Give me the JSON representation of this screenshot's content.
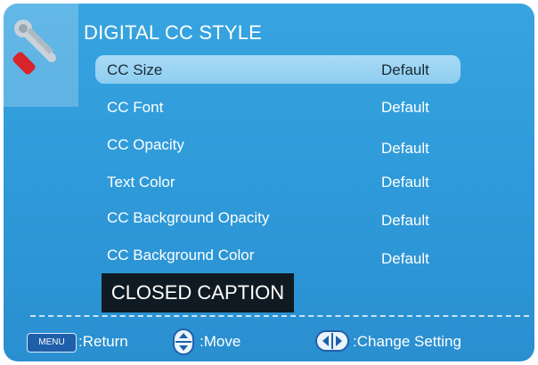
{
  "title": "DIGITAL CC STYLE",
  "menu": [
    {
      "label": "CC Size",
      "value": "Default",
      "selected": true
    },
    {
      "label": "CC Font",
      "value": "Default"
    },
    {
      "label": "CC Opacity",
      "value": "Default"
    },
    {
      "label": "Text Color",
      "value": "Default"
    },
    {
      "label": "CC Background Opacity",
      "value": "Default"
    },
    {
      "label": "CC Background Color",
      "value": "Default"
    }
  ],
  "preview_text": "CLOSED CAPTION",
  "footer": {
    "menu_key": "MENU",
    "return_label": ":Return",
    "move_label": ":Move",
    "change_label": ":Change Setting"
  },
  "icons": {
    "settings": "wrench-screwdriver-icon",
    "move": "up-down-icon",
    "change": "left-right-icon"
  },
  "colors": {
    "background": "#2f9bda",
    "highlight": "#a9dbf6",
    "preview_bg": "#0f1a22"
  }
}
